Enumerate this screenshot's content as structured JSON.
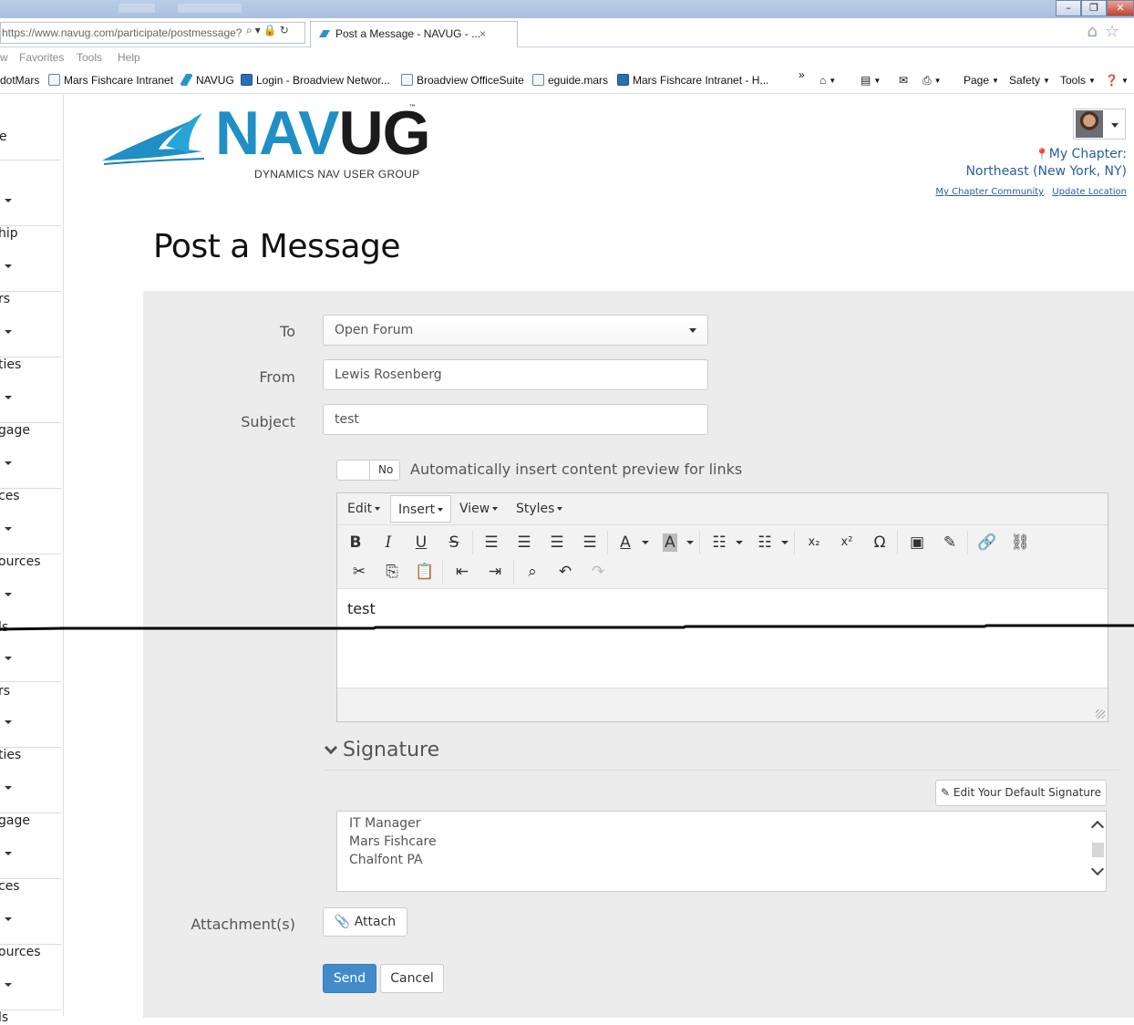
{
  "browser": {
    "url_prefix": "https://www.navug.com/participate/postmessage?",
    "tab_title": "Post a Message - NAVUG - ...",
    "tab_close": "×",
    "menu": [
      "Favorites",
      "Tools",
      "Help"
    ],
    "menu_partial": "w",
    "favorites": [
      {
        "label": "dotMars"
      },
      {
        "label": "Mars Fishcare Intranet"
      },
      {
        "label": "NAVUG"
      },
      {
        "label": "Login - Broadview Networ..."
      },
      {
        "label": "Broadview OfficeSuite"
      },
      {
        "label": "eguide.mars"
      },
      {
        "label": "Mars Fishcare Intranet - H..."
      }
    ],
    "more": "»",
    "commands": {
      "page": "Page",
      "safety": "Safety",
      "tools": "Tools"
    }
  },
  "leftnav": [
    "e",
    "hip",
    "rs",
    "ties",
    "gage",
    "ces",
    "ources",
    "ls",
    "rs",
    "ties",
    "gage",
    "ces",
    "ources",
    "ls"
  ],
  "logo": {
    "nav": "NAV",
    "ug": "UG",
    "tm": "™",
    "tagline": "DYNAMICS NAV USER GROUP"
  },
  "chapter": {
    "label": "My Chapter:",
    "name": "Northeast (New York, NY)",
    "link_community": "My Chapter Community",
    "link_update": "Update Location"
  },
  "page_title": "Post a Message",
  "form": {
    "to_label": "To",
    "to_value": "Open Forum",
    "from_label": "From",
    "from_value": "Lewis Rosenberg",
    "subject_label": "Subject",
    "subject_value": "test",
    "toggle_state": "No",
    "toggle_label": "Automatically insert content preview for links"
  },
  "editor": {
    "menus": [
      "Edit",
      "Insert",
      "View",
      "Styles"
    ],
    "content": "test"
  },
  "signature": {
    "heading": "Signature",
    "edit_button": "Edit Your Default Signature",
    "lines": [
      "IT Manager",
      "Mars Fishcare",
      "Chalfont PA"
    ]
  },
  "attachments": {
    "label": "Attachment(s)",
    "button": "Attach"
  },
  "actions": {
    "send": "Send",
    "cancel": "Cancel"
  },
  "colors": {
    "accent": "#428bca",
    "brand_blue": "#1f8fc6",
    "panel": "#ececec"
  }
}
